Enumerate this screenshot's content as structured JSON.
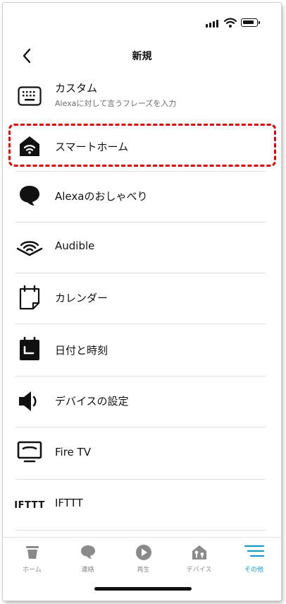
{
  "header": {
    "title": "新規",
    "back_icon": "chevron-left-icon"
  },
  "items": [
    {
      "label": "カスタム",
      "sublabel": "Alexaに対して言うフレーズを入力",
      "icon": "keyboard-icon"
    },
    {
      "label": "スマートホーム",
      "icon": "smart-home-icon",
      "highlighted": true
    },
    {
      "label": "Alexaのおしゃべり",
      "icon": "speech-bubble-icon"
    },
    {
      "label": "Audible",
      "icon": "audible-icon"
    },
    {
      "label": "カレンダー",
      "icon": "calendar-icon"
    },
    {
      "label": "日付と時刻",
      "icon": "date-time-icon"
    },
    {
      "label": "デバイスの設定",
      "icon": "speaker-icon"
    },
    {
      "label": "Fire TV",
      "icon": "tv-icon"
    },
    {
      "label": "IFTTT",
      "icon": "ifttt-logo"
    }
  ],
  "tabs": [
    {
      "label": "ホーム",
      "icon": "home-icon",
      "active": false
    },
    {
      "label": "連絡",
      "icon": "chat-icon",
      "active": false
    },
    {
      "label": "再生",
      "icon": "play-icon",
      "active": false
    },
    {
      "label": "デバイス",
      "icon": "devices-icon",
      "active": false
    },
    {
      "label": "その他",
      "icon": "menu-icon",
      "active": true
    }
  ],
  "colors": {
    "accent": "#1a98c8",
    "highlight_border": "#d40000",
    "inactive_tab": "#8a8a8a",
    "text": "#111111"
  }
}
